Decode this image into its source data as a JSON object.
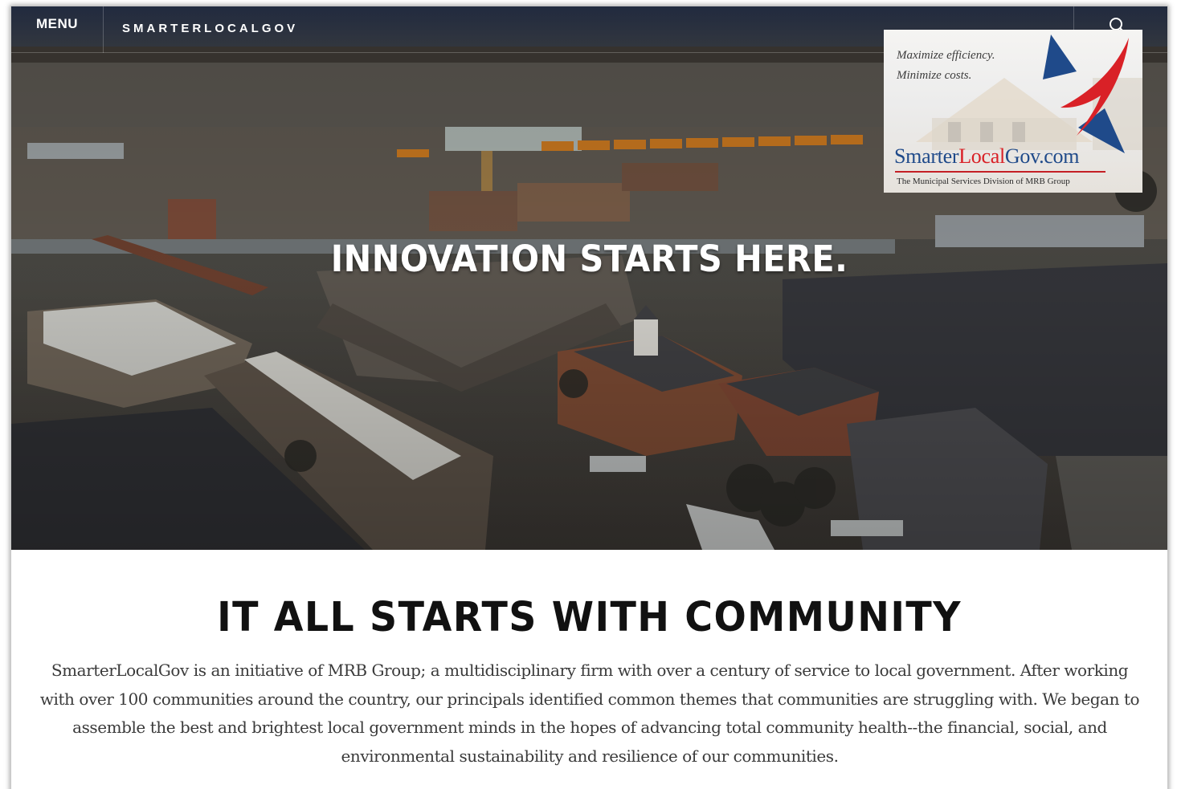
{
  "header": {
    "menu_label": "MENU",
    "site_title": "SMARTERLOCALGOV",
    "search_icon": "search-icon"
  },
  "logo": {
    "tagline_line1": "Maximize efficiency.",
    "tagline_line2": "Minimize costs.",
    "name_part1": "Smarter",
    "name_part2": "Local",
    "name_part3": "Gov.com",
    "subtitle": "The Municipal Services Division of MRB Group",
    "colors": {
      "blue": "#1f4a8a",
      "red": "#d92127"
    }
  },
  "hero": {
    "headline": "INNOVATION STARTS HERE."
  },
  "intro": {
    "title": "IT ALL STARTS WITH COMMUNITY",
    "body": "SmarterLocalGov is an initiative of MRB Group; a multidisciplinary firm with over a century of service to local government.  After working with over 100 communities around the country, our principals identified common themes that communities are struggling with.  We began to assemble the best and brightest local government minds in the hopes of advancing total community health--the financial, social, and environmental sustainability and resilience of our communities."
  }
}
